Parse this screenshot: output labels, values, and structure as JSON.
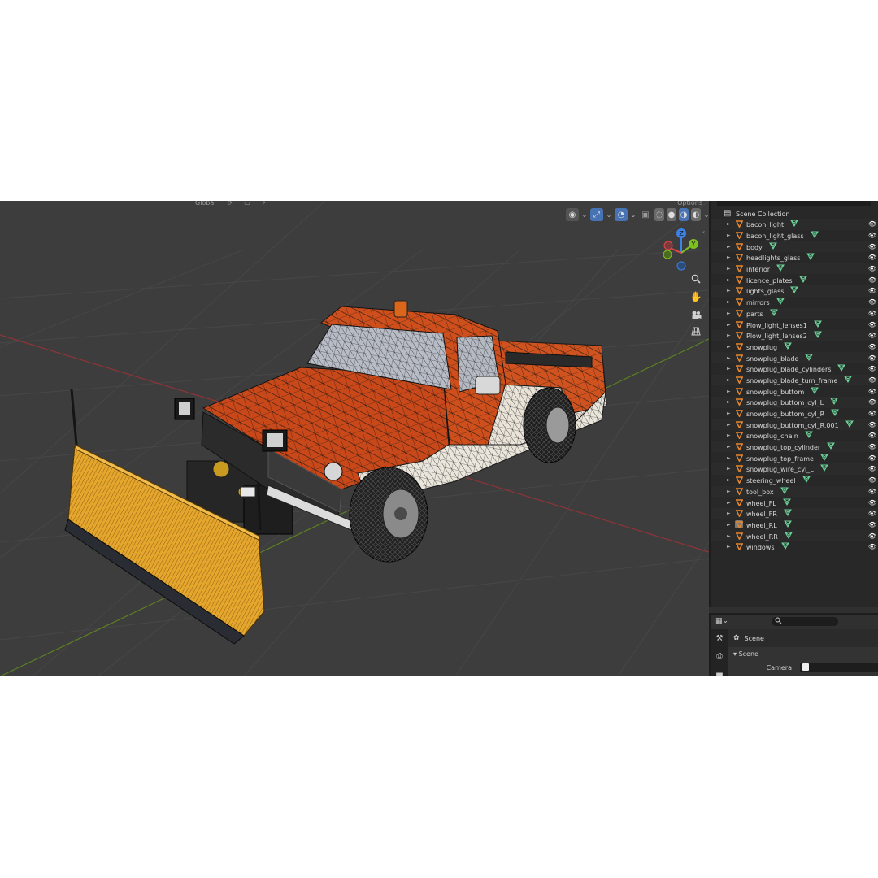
{
  "viewport": {
    "header_items": [
      "Global",
      "⟳",
      "▭",
      "⚡"
    ],
    "header_right": "Options",
    "toolbar": {
      "visibility_icon": "eye-icon",
      "gizmo_icon": "gizmo-icon",
      "overlay_icon": "overlay-icon",
      "xray_icon": "xray-icon",
      "shading_modes": [
        "wireframe",
        "solid",
        "material",
        "rendered"
      ],
      "active_shading": "material"
    },
    "axis_gizmo": {
      "z": "Z",
      "y": "Y",
      "x": "X"
    },
    "nav_tools": [
      "zoom-icon",
      "hand-pan-icon",
      "camera-icon",
      "grid-icon"
    ]
  },
  "outliner": {
    "root_label": "Scene Collection",
    "objects": [
      "bacon_light",
      "bacon_light_glass",
      "body",
      "headlights_glass",
      "interior",
      "licence_plates",
      "lights_glass",
      "mirrors",
      "parts",
      "Plow_light_lenses1",
      "Plow_light_lenses2",
      "snowplug",
      "snowplug_blade",
      "snowplug_blade_cylinders",
      "snowplug_blade_turn_frame",
      "snowplug_buttom",
      "snowplug_buttom_cyl_L",
      "snowplug_buttom_cyl_R",
      "snowplug_buttom_cyl_R.001",
      "snowplug_chain",
      "snowplug_top_cylinder",
      "snowplug_top_frame",
      "snowplug_wire_cyl_L",
      "steering_wheel",
      "tool_box",
      "wheel_FL",
      "wheel_FR",
      "wheel_RL",
      "wheel_RR",
      "windows"
    ],
    "selected_object": "wheel_RL"
  },
  "properties": {
    "active_tab": "scene",
    "context_label": "Scene",
    "panel_title": "Scene",
    "camera_label": "Camera"
  },
  "colors": {
    "viewport_bg": "#3d3d3d",
    "outliner_bg": "#282828",
    "accent_blue": "#4772b3",
    "object_orange": "#e6862b",
    "mesh_green": "#6cd39a",
    "axis_x_red": "#e4464a",
    "axis_y_green": "#7ec11e",
    "axis_z_blue": "#3d82e7",
    "truck_body": "#c84a1a",
    "plow_yellow": "#e4a42a"
  }
}
